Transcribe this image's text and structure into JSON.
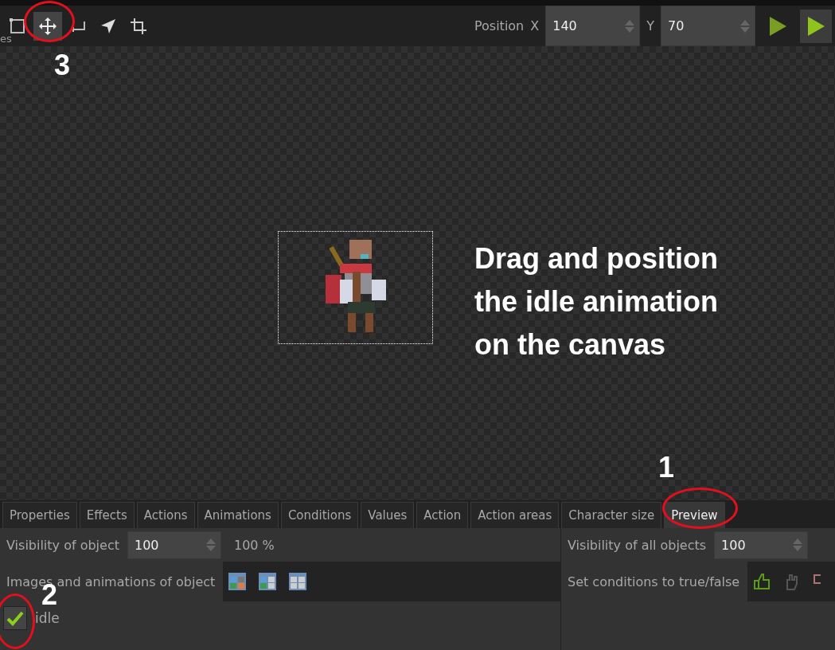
{
  "toolbar": {
    "cut_label": "es",
    "tools": [
      {
        "kind": "select-rect",
        "selected": false
      },
      {
        "kind": "move",
        "selected": true
      },
      {
        "kind": "corner",
        "selected": false
      },
      {
        "kind": "pointer",
        "selected": false
      },
      {
        "kind": "crop",
        "selected": false
      }
    ],
    "position": {
      "label": "Position",
      "x_label": "X",
      "x_value": "140",
      "y_label": "Y",
      "y_value": "70"
    },
    "play_buttons": [
      {
        "selected": false
      },
      {
        "selected": true
      }
    ]
  },
  "canvas": {
    "instruction": "Drag and position the idle animation on the canvas"
  },
  "annotations": [
    {
      "number": "3"
    },
    {
      "number": "1"
    },
    {
      "number": "2"
    }
  ],
  "tabs": [
    {
      "label": "Properties",
      "selected": false
    },
    {
      "label": "Effects",
      "selected": false
    },
    {
      "label": "Actions",
      "selected": false
    },
    {
      "label": "Animations",
      "selected": false
    },
    {
      "label": "Conditions",
      "selected": false
    },
    {
      "label": "Values",
      "selected": false
    },
    {
      "label": "Action",
      "selected": false
    },
    {
      "label": "Action areas",
      "selected": false
    },
    {
      "label": "Character size",
      "selected": false
    },
    {
      "label": "Preview",
      "selected": true
    }
  ],
  "left_panel": {
    "visibility_label": "Visibility of object",
    "visibility_value": "100",
    "visibility_percent": "100 %",
    "images_label": "Images and animations of object",
    "animations": [
      {
        "label": "idle",
        "checked": true
      }
    ]
  },
  "right_panel": {
    "visibility_label": "Visibility of all objects",
    "visibility_value": "100",
    "conditions_label": "Set conditions to true/false"
  }
}
